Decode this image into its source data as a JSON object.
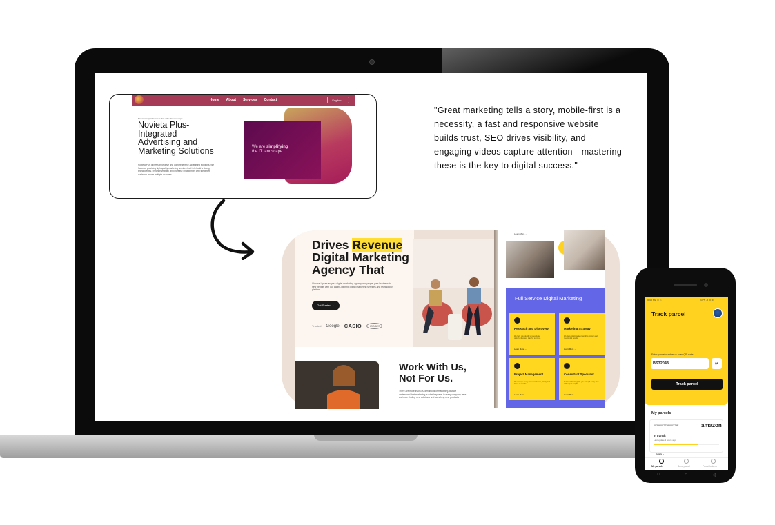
{
  "old_site": {
    "nav": {
      "home": "Home",
      "about": "About",
      "services": "Services",
      "contact": "Contact",
      "lang": "English ⌄"
    },
    "kicker": "Provides impactful ideas that drive the rest steps",
    "title": "Novieta Plus-Integrated Advertising and Marketing Solutions",
    "desc": "Novieta Plus delivers innovative and comprehensive advertising solutions. We focus on providing high-quality marketing services that help build a strong brand identity, enhance visibility, and increase engagement with the target audience across multiple channels.",
    "box_pre": "We are ",
    "box_bold": "simplifying",
    "box_post": "the IT landscape"
  },
  "quote": "\"Great marketing tells a story, mobile-first is a necessity, a fast and responsive website builds trust, SEO drives visibility, and engaging videos capture attention—mastering these is the key to digital success.\"",
  "new_site": {
    "hero_pre": "Drives ",
    "hero_highlight": "Revenue",
    "hero_post": "Digital Marketing Agency That",
    "hero_desc": "Choose Lipsex as your digital marketing agency and propel your business to new heights with our award-winning digital marketing services and technology platform.",
    "cta": "Get Started →",
    "trusted": "Trusted",
    "brands": [
      "Google",
      "CASIO",
      "HOBBES"
    ],
    "work_title": "Work With Us, Not For Us.",
    "work_desc": "There are more than 100 definitions of marketing. But we understand that marketing is what happens in every company here and now: finding new solutions and launching new products",
    "right_label": "Learn More →",
    "purple_title": "Full Service Digital Marketing",
    "services": [
      {
        "title": "Research and Discovery",
        "desc": "We help you identify and evaluate opportunities and plan for success.",
        "more": "Learn More →"
      },
      {
        "title": "Marketing Strategy",
        "desc": "We develop strategies that drive growth and meaningful results.",
        "more": "Learn More →"
      },
      {
        "title": "Project Management",
        "desc": "We manage every project with care, clarity and focus on results.",
        "more": "Learn More →"
      },
      {
        "title": "Consultant Specialist",
        "desc": "Our consultants guide you through every step with expert insight.",
        "more": "Learn More →"
      }
    ]
  },
  "phone": {
    "status_left": "5:48 PM ◎ ▷",
    "status_right": "⊙ ᯤ ⊿ .ıl ⊞",
    "title": "Track parcel",
    "input_label": "Enter parcel number or scan QR code",
    "input_value": "BS32043",
    "qr": "QR",
    "button": "Track parcel",
    "my_parcels": "My parcels",
    "parcel_number": "00359007738600379E",
    "brand": "amazon",
    "status": "In transit",
    "status_detail": "Last update 3 hours ago",
    "more": "Details ⌄",
    "tabs": [
      "My parcels",
      "Send parcel",
      "Parcel lockers"
    ]
  },
  "colors": {
    "old_brand": "#a63b57",
    "yellow": "#ffd21f",
    "purple": "#6466e8",
    "dark": "#1b1b1b"
  }
}
